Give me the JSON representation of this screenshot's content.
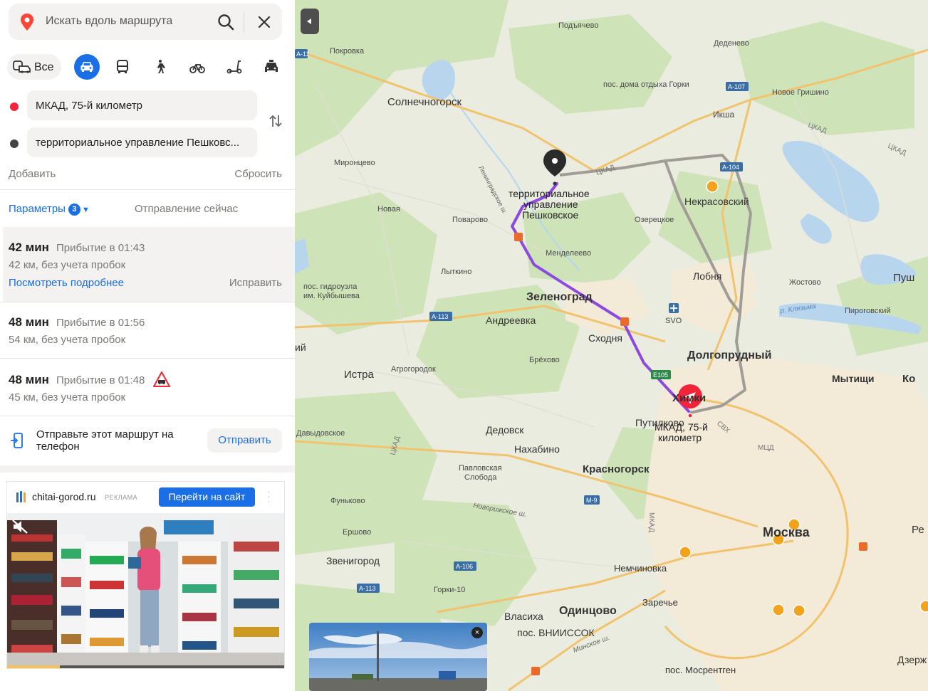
{
  "search": {
    "placeholder": "Искать вдоль маршрута"
  },
  "modes": {
    "all_label": "Все",
    "active": "car"
  },
  "waypoints": {
    "from": "МКАД, 75-й километр",
    "to": "территориальное управление Пешковс..."
  },
  "actions": {
    "add": "Добавить",
    "reset": "Сбросить"
  },
  "params": {
    "label": "Параметры",
    "count": "3",
    "departure": "Отправление сейчас"
  },
  "routes": [
    {
      "duration": "42 мин",
      "arrival": "Прибытие в 01:43",
      "distance": "42 км, без учета пробок",
      "details_link": "Посмотреть подробнее",
      "fix_link": "Исправить"
    },
    {
      "duration": "48 мин",
      "arrival": "Прибытие в 01:56",
      "distance": "54 км, без учета пробок"
    },
    {
      "duration": "48 мин",
      "arrival": "Прибытие в 01:48",
      "distance": "45 км, без учета пробок",
      "warning": "road-sign-icon"
    }
  ],
  "send_to_phone": {
    "text": "Отправьте этот маршрут на телефон",
    "button": "Отправить"
  },
  "ad": {
    "domain": "chitai-gorod.ru",
    "label": "РЕКЛАМА",
    "button": "Перейти на сайт",
    "progress": 0.19
  },
  "map": {
    "colors": {
      "route": "#8c4ae0",
      "alt_route": "#a09c96",
      "water": "#b7d6ee",
      "forest": "#cde2b5",
      "city": "#f6ebd8",
      "road": "#f1c36d"
    },
    "labels": {
      "podyachevo": "Подъячево",
      "dedenevo": "Деденево",
      "pokrovka": "Покровка",
      "gorki": "пос. дома отдыха Горки",
      "novoe_grishino": "Новое Гришино",
      "solnechnogorsk": "Солнечногорск",
      "iksha": "Икша",
      "ckad1": "ЦКАД",
      "ckad2": "ЦКАД",
      "ckad3": "ЦКАД",
      "ckad4": "ЦКАД",
      "mironcevo": "Миронцево",
      "nekrasovsky": "Некрасовский",
      "novaya": "Новая",
      "povarovo": "Поварово",
      "ozereckoe": "Озерецкое",
      "leningradskoe": "Ленинградское ш.",
      "destination": "территориальное управление Пешковское",
      "mendeleevo": "Менделеево",
      "lytkino": "Лыткино",
      "lobnya": "Лобня",
      "zhostovo": "Жостово",
      "push": "Пуш",
      "gidrouzel": "пос. гидроузла им. Куйбышева",
      "zelenograd": "Зеленоград",
      "klyazma": "р. Клязьма",
      "pirogovsky": "Пироговский",
      "andreevka": "Андреевка",
      "svo": "SVO",
      "skhodnya": "Сходня",
      "dolgoprudny": "Долгопрудный",
      "brekhovo": "Брёхово",
      "agrogorodok": "Агрогородок",
      "istra": "Истра",
      "mytishchi": "Мытищи",
      "ko": "Ко",
      "khimki": "Химки",
      "putilkovo": "Путилково",
      "origin": "МКАД, 75-й километр",
      "davydovskoe": "Давыдовское",
      "dedovsk": "Дедовск",
      "mcd": "МЦД",
      "sv": "СВХ",
      "nakhabino": "Нахабино",
      "pavlovskaya": "Павловская Слобода",
      "krasnogorsk": "Красногорск",
      "funkovo": "Фуньково",
      "novorizhskoe": "Новорижское ш.",
      "ershovo": "Ершово",
      "mkad": "МКАД",
      "moskva": "Москва",
      "re": "Ре",
      "zvenigorod": "Звенигород",
      "nemchinovka": "Немчиновка",
      "gorki10": "Горки-10",
      "zarechye": "Заречье",
      "vlasikha": "Власиха",
      "odintsovo": "Одинцово",
      "vniissok": "пос. ВНИИССОК",
      "minskoe": "Минское ш.",
      "mosrentgen": "пос. Мосрентген",
      "dzerzh": "Дзерж",
      "ii": "ий"
    },
    "highway_badges": {
      "a11": "А-11",
      "a107": "А-107",
      "a104": "А-104",
      "a113a": "А-113",
      "e105": "E105",
      "m9": "М-9",
      "a106": "А-106",
      "a113b": "А-113"
    }
  }
}
